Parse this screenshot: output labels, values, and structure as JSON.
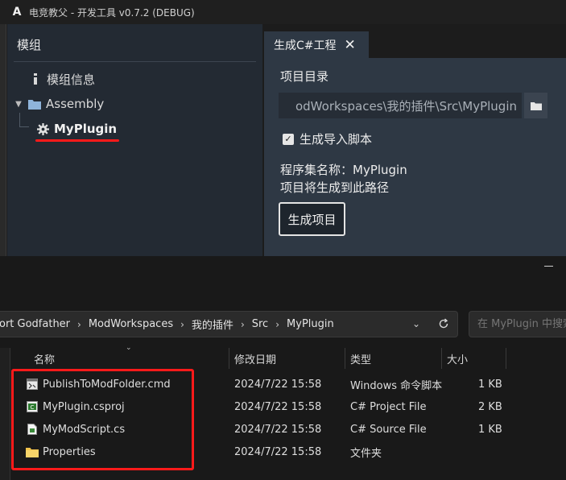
{
  "app": {
    "title": "电竞教父 - 开发工具 v0.7.2 (DEBUG)",
    "logo_glyph": "A"
  },
  "left_panel": {
    "header": "模组",
    "tree": [
      {
        "label": "模组信息",
        "icon": "info-icon"
      },
      {
        "label": "Assembly",
        "icon": "folder-icon",
        "expanded": true
      },
      {
        "label": "MyPlugin",
        "icon": "gear-icon",
        "selected": true
      }
    ]
  },
  "tab": {
    "label": "生成C#工程",
    "close_glyph": "✕"
  },
  "form": {
    "dir_label": "项目目录",
    "dir_value": "odWorkspaces\\我的插件\\Src\\MyPlugin",
    "checkbox_label": "生成导入脚本",
    "checkbox_checked": true,
    "assembly_name": "程序集名称：MyPlugin",
    "hint": "项目将生成到此路径",
    "generate_button": "生成项目"
  },
  "explorer": {
    "breadcrumbs": [
      "ort Godfather",
      "ModWorkspaces",
      "我的插件",
      "Src",
      "MyPlugin"
    ],
    "search_placeholder": "在 MyPlugin 中搜索",
    "columns": [
      "名称",
      "修改日期",
      "类型",
      "大小"
    ],
    "files": [
      {
        "name": "PublishToModFolder.cmd",
        "date": "2024/7/22 15:58",
        "type": "Windows 命令脚本",
        "size": "1 KB",
        "icon": "cmd-file-icon"
      },
      {
        "name": "MyPlugin.csproj",
        "date": "2024/7/22 15:58",
        "type": "C# Project File",
        "size": "2 KB",
        "icon": "csproj-file-icon"
      },
      {
        "name": "MyModScript.cs",
        "date": "2024/7/22 15:58",
        "type": "C# Source File",
        "size": "1 KB",
        "icon": "cs-file-icon"
      },
      {
        "name": "Properties",
        "date": "2024/7/22 15:58",
        "type": "文件夹",
        "size": "",
        "icon": "folder-icon"
      }
    ]
  },
  "colors": {
    "highlight": "#ff1a1a",
    "panel": "#2e3844",
    "tree_panel": "#232a33"
  }
}
